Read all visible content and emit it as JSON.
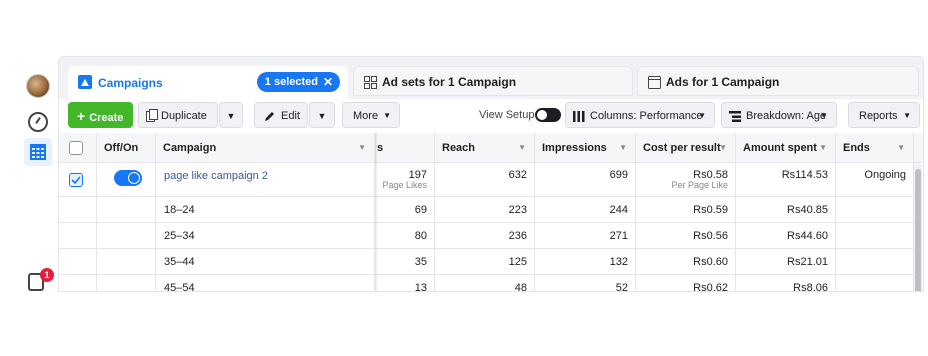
{
  "rail": {
    "notification_count": "1"
  },
  "tabs": {
    "campaigns": "Campaigns",
    "selected_pill": "1 selected",
    "adsets": "Ad sets for 1 Campaign",
    "ads": "Ads for 1 Campaign"
  },
  "toolbar": {
    "create": "Create",
    "duplicate": "Duplicate",
    "edit": "Edit",
    "more": "More",
    "view_setup": "View Setup",
    "columns": "Columns: Performance",
    "breakdown": "Breakdown: Age",
    "reports": "Reports"
  },
  "table": {
    "headers": {
      "offon": "Off/On",
      "campaign": "Campaign",
      "results_partial": "s",
      "reach": "Reach",
      "impressions": "Impressions",
      "cost": "Cost per result",
      "amount": "Amount spent",
      "ends": "Ends"
    },
    "main_row": {
      "campaign": "page like campaign 2",
      "results": "197",
      "results_sub": "Page Likes",
      "reach": "632",
      "impressions": "699",
      "cost": "Rs0.58",
      "cost_sub": "Per Page Like",
      "amount": "Rs114.53",
      "ends": "Ongoing"
    },
    "rows": [
      {
        "campaign": "18–24",
        "results": "69",
        "reach": "223",
        "impressions": "244",
        "cost": "Rs0.59",
        "amount": "Rs40.85"
      },
      {
        "campaign": "25–34",
        "results": "80",
        "reach": "236",
        "impressions": "271",
        "cost": "Rs0.56",
        "amount": "Rs44.60"
      },
      {
        "campaign": "35–44",
        "results": "35",
        "reach": "125",
        "impressions": "132",
        "cost": "Rs0.60",
        "amount": "Rs21.01"
      },
      {
        "campaign": "45–54",
        "results": "13",
        "reach": "48",
        "impressions": "52",
        "cost": "Rs0.62",
        "amount": "Rs8.06"
      }
    ]
  },
  "colors": {
    "accent": "#1877f2",
    "create_green": "#42b72a",
    "badge_red": "#e41e3f"
  }
}
